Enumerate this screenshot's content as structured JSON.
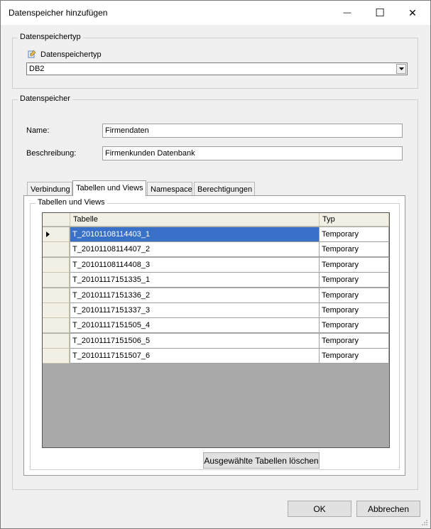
{
  "window": {
    "title": "Datenspeicher hinzufügen",
    "controls": {
      "minimize": "—",
      "maximize": "☐",
      "close": "✕"
    }
  },
  "typ_group": {
    "legend": "Datenspeichertyp",
    "label": "Datenspeichertyp",
    "icon": "edit-pencil-icon",
    "selected": "DB2"
  },
  "store_group": {
    "legend": "Datenspeicher",
    "name_label": "Name:",
    "name_value": "Firmendaten",
    "desc_label": "Beschreibung:",
    "desc_value": "Firmenkunden Datenbank"
  },
  "tabs": [
    {
      "label": "Verbindung"
    },
    {
      "label": "Tabellen und Views"
    },
    {
      "label": "Namespace"
    },
    {
      "label": "Berechtigungen"
    }
  ],
  "active_tab": "Tabellen und Views",
  "tables_group": {
    "legend": "Tabellen und Views",
    "columns": [
      "Tabelle",
      "Typ"
    ],
    "rows": [
      {
        "tabelle": "T_20101108114403_1",
        "typ": "Temporary"
      },
      {
        "tabelle": "T_20101108114407_2",
        "typ": "Temporary"
      },
      {
        "tabelle": "T_20101108114408_3",
        "typ": "Temporary"
      },
      {
        "tabelle": "T_20101117151335_1",
        "typ": "Temporary"
      },
      {
        "tabelle": "T_20101117151336_2",
        "typ": "Temporary"
      },
      {
        "tabelle": "T_20101117151337_3",
        "typ": "Temporary"
      },
      {
        "tabelle": "T_20101117151505_4",
        "typ": "Temporary"
      },
      {
        "tabelle": "T_20101117151506_5",
        "typ": "Temporary"
      },
      {
        "tabelle": "T_20101117151507_6",
        "typ": "Temporary"
      }
    ],
    "selected_row": 0,
    "delete_button": "Ausgewählte Tabellen löschen"
  },
  "footer": {
    "ok": "OK",
    "cancel": "Abbrechen"
  },
  "colors": {
    "selection": "#3a71c8",
    "grid_bg": "#a9a9a9",
    "header_bg": "#f2f0e4"
  }
}
